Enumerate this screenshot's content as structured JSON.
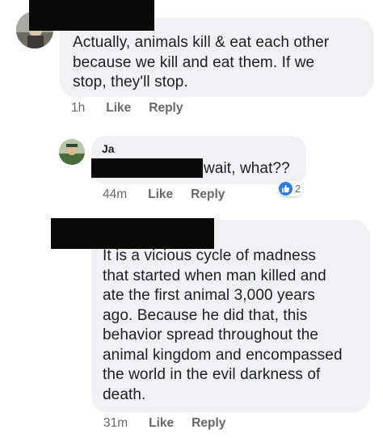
{
  "comments": [
    {
      "text": "Actually, animals kill & eat each other\nbecause we kill and eat them. If we\nstop, they'll stop.",
      "time": "1h",
      "like_label": "Like",
      "reply_label": "Reply"
    },
    {
      "author": "Ja",
      "text": "wait, what??",
      "time": "44m",
      "like_label": "Like",
      "reply_label": "Reply",
      "reaction_count": "2",
      "reaction_icon": "thumbs-up-icon",
      "reaction_color": "#2d7be5"
    },
    {
      "text": "It is a vicious cycle of madness\nthat started when man killed and\nate the first animal 3,000 years\nago. Because he did that, this\nbehavior spread throughout the\nanimal kingdom and encompassed\nthe world in the evil darkness of\ndeath.",
      "time": "31m",
      "like_label": "Like",
      "reply_label": "Reply"
    }
  ],
  "colors": {
    "bubble": "#eff1f4",
    "meta_text": "#65676b",
    "redaction": "#0a0a0a"
  }
}
